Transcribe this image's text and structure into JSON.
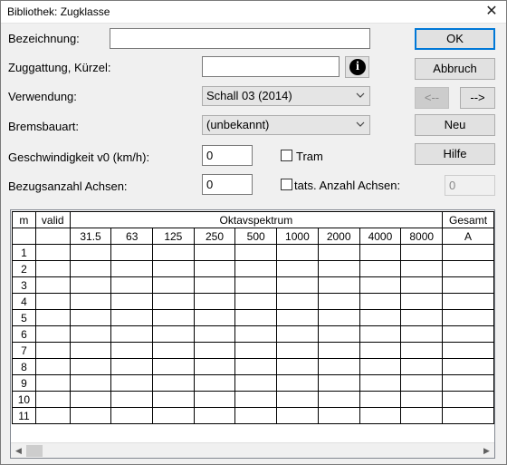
{
  "window": {
    "title": "Bibliothek: Zugklasse",
    "close_glyph": "✕"
  },
  "form": {
    "bezeichnung_label": "Bezeichnung:",
    "bezeichnung_value": "",
    "zuggattung_label": "Zuggattung, Kürzel:",
    "zuggattung_value": "",
    "info_glyph": "i",
    "verwendung_label": "Verwendung:",
    "verwendung_value": "Schall 03 (2014)",
    "bremsbauart_label": "Bremsbauart:",
    "bremsbauart_value": "(unbekannt)",
    "geschwindigkeit_label": "Geschwindigkeit v0 (km/h):",
    "geschwindigkeit_value": "0",
    "tram_label": "Tram",
    "tram_checked": false,
    "bezugsanzahl_label": "Bezugsanzahl Achsen:",
    "bezugsanzahl_value": "0",
    "tats_label": "tats. Anzahl Achsen:",
    "tats_checked": false,
    "tats_value": "0"
  },
  "buttons": {
    "ok": "OK",
    "abbruch": "Abbruch",
    "prev": "<--",
    "next": "-->",
    "neu": "Neu",
    "hilfe": "Hilfe"
  },
  "grid": {
    "header_row1": {
      "m": "m",
      "valid": "valid",
      "spectrum": "Oktavspektrum",
      "gesamt": "Gesamt"
    },
    "frequencies": [
      "31.5",
      "63",
      "125",
      "250",
      "500",
      "1000",
      "2000",
      "4000",
      "8000"
    ],
    "gesamt_unit": "A",
    "rows": [
      "1",
      "2",
      "3",
      "4",
      "5",
      "6",
      "7",
      "8",
      "9",
      "10",
      "11"
    ]
  },
  "scrollbar": {
    "left_arrow": "◀",
    "right_arrow": "▶"
  }
}
